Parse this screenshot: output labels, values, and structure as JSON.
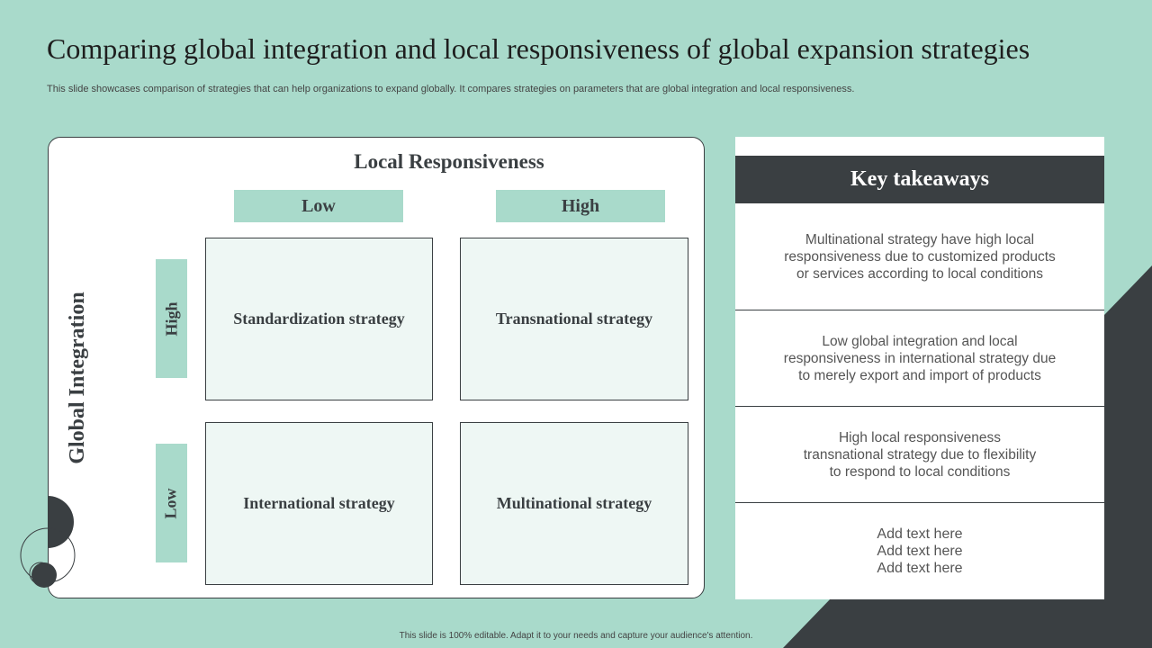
{
  "page": {
    "title": "Comparing global integration and local responsiveness of global expansion strategies",
    "subtitle": "This slide showcases comparison of strategies that can help organizations to expand globally. It compares strategies on parameters that are global integration and local responsiveness.",
    "footer": "This slide is 100% editable. Adapt it to your needs and capture your audience's attention."
  },
  "matrix": {
    "x_axis_label": "Local Responsiveness",
    "y_axis_label": "Global Integration",
    "columns": [
      "Low",
      "High"
    ],
    "rows": [
      "High",
      "Low"
    ],
    "cells": {
      "high_low": "Standardization strategy",
      "high_high": "Transnational strategy",
      "low_low": "International strategy",
      "low_high": "Multinational strategy"
    }
  },
  "key_takeaways": {
    "title": "Key takeaways",
    "items": [
      "Multinational strategy have high local\nresponsiveness due to customized products\nor services according to local conditions",
      "Low global integration and local\nresponsiveness in international strategy due\nto merely export and import of products",
      "High local responsiveness\ntransnational strategy due to flexibility\nto respond to local conditions",
      "Add text here\nAdd text here\nAdd text here"
    ]
  },
  "colors": {
    "background": "#a9dacb",
    "dark": "#3a3f42",
    "cell_fill": "#eef7f4",
    "white": "#ffffff"
  }
}
